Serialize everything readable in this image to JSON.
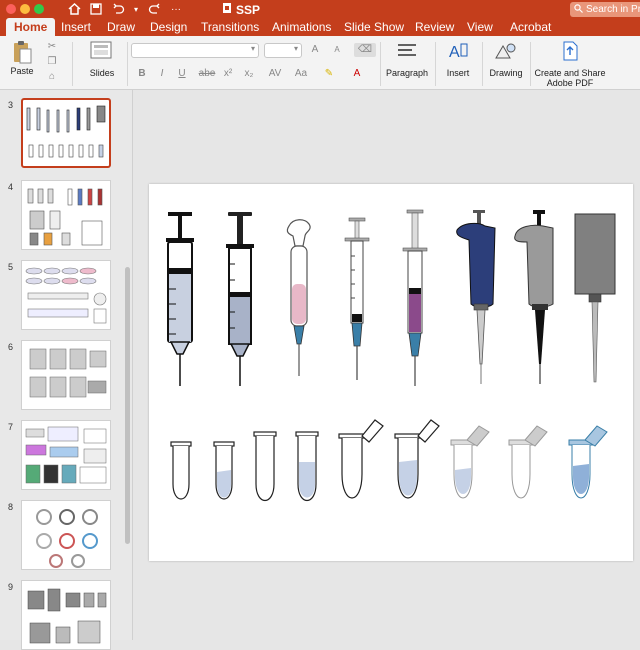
{
  "window": {
    "title": "SSP"
  },
  "search": {
    "placeholder": "Search in Presentation"
  },
  "tabs": [
    "Home",
    "Insert",
    "Draw",
    "Design",
    "Transitions",
    "Animations",
    "Slide Show",
    "Review",
    "View",
    "Acrobat"
  ],
  "ribbon": {
    "paste_label": "Paste",
    "slides_label": "Slides",
    "paragraph_label": "Paragraph",
    "insert_label": "Insert",
    "drawing_label": "Drawing",
    "adobe_label_line1": "Create and Share",
    "adobe_label_line2": "Adobe PDF",
    "font_buttons": [
      "B",
      "I",
      "U",
      "abe",
      "x²",
      "x₂"
    ],
    "size_buttons": [
      "A",
      "A"
    ]
  },
  "slides": [
    {
      "number": "3",
      "selected": true
    },
    {
      "number": "4",
      "selected": false
    },
    {
      "number": "5",
      "selected": false
    },
    {
      "number": "6",
      "selected": false
    },
    {
      "number": "7",
      "selected": false
    },
    {
      "number": "8",
      "selected": false
    },
    {
      "number": "9",
      "selected": false
    }
  ],
  "colors": {
    "accent": "#c43e1c",
    "syringe_fill": "#c8d0e0",
    "tube_fill": "#c5d1e6",
    "pipette_blue": "#2c3e7a",
    "pink_fill": "#e8b8c8",
    "purple_fill": "#8b4a8b",
    "gray_fill": "#9a9a9a",
    "teal": "#3a7fa8"
  }
}
